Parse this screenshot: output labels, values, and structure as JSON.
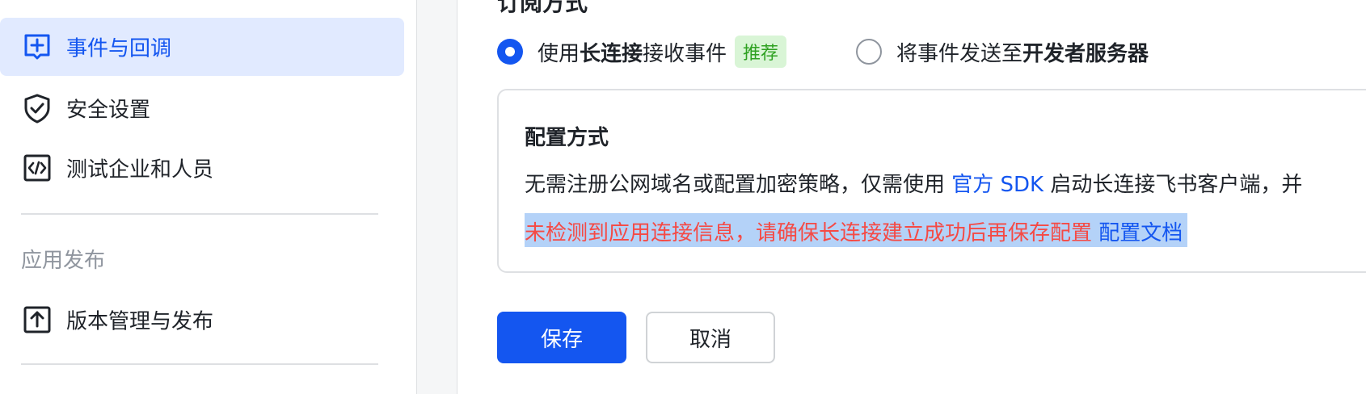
{
  "sidebar": {
    "items": [
      {
        "label": "事件与回调",
        "icon": "add-box-icon",
        "active": true
      },
      {
        "label": "安全设置",
        "icon": "shield-check-icon"
      },
      {
        "label": "测试企业和人员",
        "icon": "code-box-icon"
      },
      {
        "label": "版本管理与发布",
        "icon": "upload-box-icon"
      }
    ],
    "group_title": "应用发布"
  },
  "main": {
    "section_title": "订阅方式",
    "option_long_connection": {
      "prefix": "使用 ",
      "bold": "长连接",
      "suffix": " 接收事件",
      "tag": "推荐"
    },
    "option_server": {
      "prefix": "将事件发送至 ",
      "bold": "开发者服务器"
    },
    "panel": {
      "title": "配置方式",
      "desc_prefix": "无需注册公网域名或配置加密策略，仅需使用 ",
      "desc_link": "官方 SDK",
      "desc_suffix": " 启动长连接飞书客户端，并",
      "warning": "未检测到应用连接信息，请确保长连接建立成功后再保存配置 ",
      "warning_link": "配置文档"
    },
    "save_label": "保存",
    "cancel_label": "取消"
  },
  "colors": {
    "accent": "#1456f0",
    "active_bg": "#e1eaff",
    "warning": "#f54a45",
    "tag_bg": "#d9f5d6",
    "tag_text": "#2ea121"
  }
}
